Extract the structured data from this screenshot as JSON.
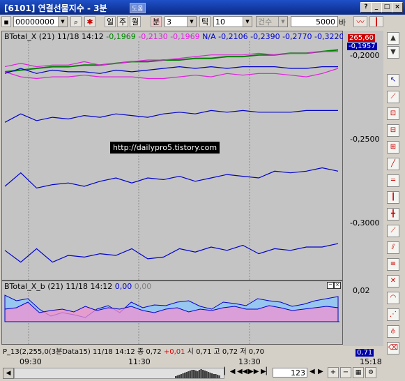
{
  "window": {
    "title": "[6101] 연결선물지수 - 3분",
    "title_chip": "도움",
    "controls": [
      "?",
      "_",
      "□",
      "×"
    ]
  },
  "toolbar": {
    "code": "00000000",
    "btn_day": "일",
    "btn_week": "주",
    "btn_month": "월",
    "btn_minute": "분",
    "minute_value": "3",
    "btn_tick": "틱",
    "tick_value": "10",
    "count_label": "건수",
    "count_value": "5000",
    "count_unit": "바"
  },
  "main_legend": {
    "name": "BTotal_X",
    "params": "(21) 11/18 14:12",
    "v1": "-0,1969",
    "v2": "-0,2130",
    "v3": "-0,1969",
    "na": "N/A",
    "v4": "-0,2106",
    "v5": "-0,2390",
    "v6": "-0,2770",
    "v7": "-0,3220"
  },
  "lower_legend": {
    "name": "BTotal_X_b",
    "params": "(21) 11/18 14:12",
    "v1": "0,00",
    "v2": "0,00"
  },
  "status_legend": {
    "text": "P_13(2,255,0(3분Data15) 11/18 14:12",
    "jong_label": "종",
    "jong": "0,72",
    "change": "+0,01",
    "si_label": "시",
    "si": "0,71",
    "go_label": "고",
    "go": "0,72",
    "jeo_label": "저",
    "jeo": "0,70"
  },
  "watermark": "http://dailypro5.tistory.com",
  "y_axis": {
    "top_marker": "265,60",
    "current_marker": "-0,1957",
    "labels": [
      "-0,2000",
      "-0,2500",
      "-0,3000"
    ],
    "lower_label": "0,02",
    "bottom_marker": "0,71"
  },
  "x_axis": {
    "labels": [
      "09:30",
      "11:30",
      "13:30",
      "15:18"
    ]
  },
  "bottom_bar": {
    "bar_count": "123"
  },
  "colors": {
    "green": "#008000",
    "magenta": "#e020e0",
    "blue": "#0000cc",
    "panel_bg": "#c4c4c4"
  },
  "chart_data": {
    "type": "line",
    "x_range": [
      "09:30",
      "15:18"
    ],
    "ylim": [
      -0.33,
      -0.19
    ],
    "series": [
      {
        "name": "BTotal_X",
        "color": "#008000",
        "values": [
          -0.209,
          -0.208,
          -0.207,
          -0.206,
          -0.206,
          -0.205,
          -0.205,
          -0.204,
          -0.203,
          -0.203,
          -0.202,
          -0.202,
          -0.201,
          -0.201,
          -0.2,
          -0.2,
          -0.199,
          -0.199,
          -0.198,
          -0.198,
          -0.197,
          -0.196
        ]
      },
      {
        "name": "",
        "color": "#e020e0",
        "values": [
          -0.206,
          -0.204,
          -0.206,
          -0.205,
          -0.205,
          -0.203,
          -0.205,
          -0.204,
          -0.203,
          -0.202,
          -0.202,
          -0.201,
          -0.2,
          -0.199,
          -0.199,
          -0.199,
          -0.198,
          -0.199,
          -0.198,
          -0.198,
          -0.197,
          -0.197
        ]
      },
      {
        "name": "",
        "color": "#e020e0",
        "values": [
          -0.209,
          -0.212,
          -0.213,
          -0.212,
          -0.212,
          -0.211,
          -0.212,
          -0.212,
          -0.212,
          -0.213,
          -0.213,
          -0.212,
          -0.211,
          -0.212,
          -0.21,
          -0.211,
          -0.21,
          -0.21,
          -0.211,
          -0.212,
          -0.21,
          -0.207
        ]
      },
      {
        "name": "",
        "color": "#0000cc",
        "values": [
          -0.21,
          -0.207,
          -0.21,
          -0.208,
          -0.209,
          -0.209,
          -0.21,
          -0.208,
          -0.209,
          -0.208,
          -0.207,
          -0.206,
          -0.207,
          -0.206,
          -0.207,
          -0.206,
          -0.206,
          -0.206,
          -0.207,
          -0.207,
          -0.206,
          -0.206
        ]
      },
      {
        "name": "",
        "color": "#0000cc",
        "values": [
          -0.239,
          -0.234,
          -0.238,
          -0.236,
          -0.237,
          -0.235,
          -0.236,
          -0.234,
          -0.235,
          -0.236,
          -0.234,
          -0.233,
          -0.234,
          -0.232,
          -0.233,
          -0.232,
          -0.233,
          -0.233,
          -0.233,
          -0.232,
          -0.232,
          -0.232
        ]
      },
      {
        "name": "",
        "color": "#0000cc",
        "values": [
          -0.277,
          -0.269,
          -0.278,
          -0.276,
          -0.275,
          -0.277,
          -0.274,
          -0.272,
          -0.275,
          -0.272,
          -0.273,
          -0.271,
          -0.274,
          -0.272,
          -0.27,
          -0.271,
          -0.272,
          -0.268,
          -0.269,
          -0.268,
          -0.266,
          -0.268
        ]
      },
      {
        "name": "",
        "color": "#0000cc",
        "values": [
          -0.315,
          -0.322,
          -0.314,
          -0.322,
          -0.318,
          -0.319,
          -0.317,
          -0.318,
          -0.314,
          -0.32,
          -0.319,
          -0.314,
          -0.316,
          -0.313,
          -0.315,
          -0.312,
          -0.317,
          -0.314,
          -0.315,
          -0.313,
          -0.313,
          -0.311
        ]
      }
    ]
  }
}
